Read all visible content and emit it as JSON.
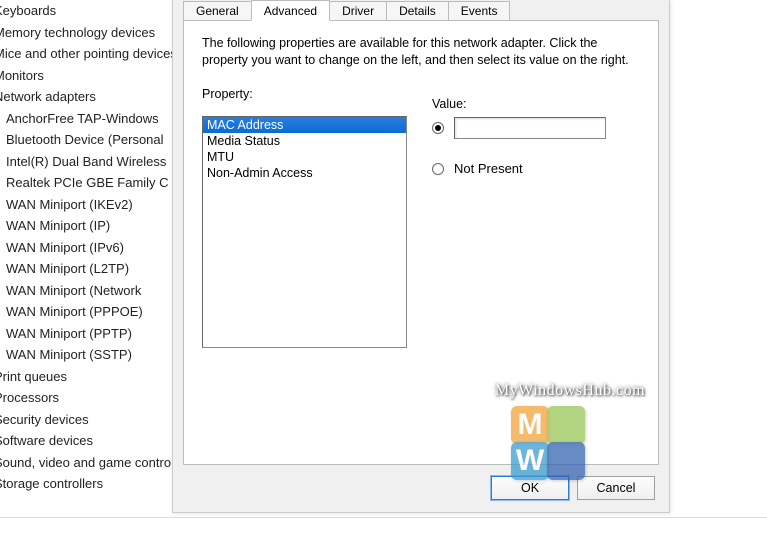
{
  "tree": {
    "items": [
      {
        "label": "Keyboards",
        "sub": false
      },
      {
        "label": "Memory technology devices",
        "sub": false
      },
      {
        "label": "Mice and other pointing devices",
        "sub": false
      },
      {
        "label": "Monitors",
        "sub": false
      },
      {
        "label": "Network adapters",
        "sub": false
      },
      {
        "label": "AnchorFree TAP-Windows",
        "sub": true
      },
      {
        "label": "Bluetooth Device (Personal",
        "sub": true
      },
      {
        "label": "Intel(R) Dual Band Wireless",
        "sub": true
      },
      {
        "label": "Realtek PCIe GBE Family C",
        "sub": true
      },
      {
        "label": "WAN Miniport (IKEv2)",
        "sub": true
      },
      {
        "label": "WAN Miniport (IP)",
        "sub": true
      },
      {
        "label": "WAN Miniport (IPv6)",
        "sub": true
      },
      {
        "label": "WAN Miniport (L2TP)",
        "sub": true
      },
      {
        "label": "WAN Miniport (Network",
        "sub": true
      },
      {
        "label": "WAN Miniport (PPPOE)",
        "sub": true
      },
      {
        "label": "WAN Miniport (PPTP)",
        "sub": true
      },
      {
        "label": "WAN Miniport (SSTP)",
        "sub": true
      },
      {
        "label": "Print queues",
        "sub": false
      },
      {
        "label": "Processors",
        "sub": false
      },
      {
        "label": "Security devices",
        "sub": false
      },
      {
        "label": "Software devices",
        "sub": false
      },
      {
        "label": "Sound, video and game controllers",
        "sub": false
      },
      {
        "label": "Storage controllers",
        "sub": false
      }
    ]
  },
  "tabs": {
    "general": "General",
    "advanced": "Advanced",
    "driver": "Driver",
    "details": "Details",
    "events": "Events"
  },
  "advanced": {
    "description": "The following properties are available for this network adapter. Click the property you want to change on the left, and then select its value on the right.",
    "property_label": "Property:",
    "value_label": "Value:",
    "properties": [
      "MAC Address",
      "Media Status",
      "MTU",
      "Non-Admin Access"
    ],
    "selected_index": 0,
    "value_input": "",
    "not_present_label": "Not Present",
    "radio_selected": "value"
  },
  "buttons": {
    "ok": "OK",
    "cancel": "Cancel"
  },
  "watermark": {
    "text": "MyWindowsHub.com",
    "letters": {
      "a": "M",
      "c": "W"
    }
  }
}
